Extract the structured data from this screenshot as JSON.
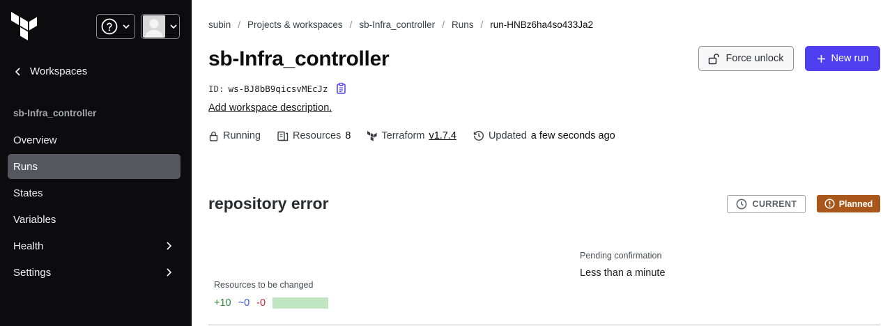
{
  "sidebar": {
    "back_label": "Workspaces",
    "workspace_name": "sb-Infra_controller",
    "items": [
      {
        "label": "Overview",
        "active": false,
        "has_chevron": false
      },
      {
        "label": "Runs",
        "active": true,
        "has_chevron": false
      },
      {
        "label": "States",
        "active": false,
        "has_chevron": false
      },
      {
        "label": "Variables",
        "active": false,
        "has_chevron": false
      },
      {
        "label": "Health",
        "active": false,
        "has_chevron": true
      },
      {
        "label": "Settings",
        "active": false,
        "has_chevron": true
      }
    ]
  },
  "breadcrumb": [
    "subin",
    "Projects & workspaces",
    "sb-Infra_controller",
    "Runs",
    "run-HNBz6ha4so433Ja2"
  ],
  "header": {
    "title": "sb-Infra_controller",
    "force_unlock_label": "Force unlock",
    "new_run_label": "New run",
    "id_label": "ID:",
    "id_value": "ws-BJ8bB9qicsvMEcJz",
    "description_link": "Add workspace description."
  },
  "meta": {
    "status": "Running",
    "resources_label": "Resources",
    "resources_count": "8",
    "terraform_label": "Terraform",
    "terraform_version": "v1.7.4",
    "updated_label": "Updated",
    "updated_value": "a few seconds ago"
  },
  "run": {
    "title": "repository error",
    "current_badge": "CURRENT",
    "status_badge": "Planned",
    "pending_label": "Pending confirmation",
    "pending_value": "Less than a minute",
    "resources_label": "Resources to be changed",
    "add": "+10",
    "change": "~0",
    "destroy": "-0"
  },
  "colors": {
    "primary": "#4f3ff0",
    "planned": "#a9561b",
    "sidebar_bg": "#0c0c0e",
    "nav_active": "#56565f",
    "add": "#2e8a3f",
    "change": "#3f56e8",
    "destroy": "#c6263b"
  },
  "icons": [
    "terraform-logo",
    "help-icon",
    "chevron-down-icon",
    "avatar",
    "chevron-left-icon",
    "chevron-right-icon",
    "unlock-icon",
    "plus-icon",
    "clipboard-icon",
    "lock-icon",
    "resources-icon",
    "terraform-icon",
    "history-icon",
    "clock-icon",
    "alert-circle-icon"
  ]
}
